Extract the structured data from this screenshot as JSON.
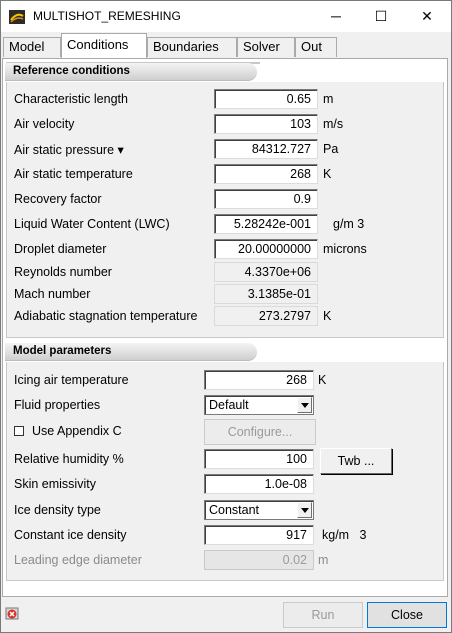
{
  "window": {
    "title": "MULTISHOT_REMESHING",
    "minimize": "─",
    "maximize": "☐",
    "close": "✕"
  },
  "tabs": [
    {
      "label": "Model"
    },
    {
      "label": "Conditions"
    },
    {
      "label": "Boundaries"
    },
    {
      "label": "Solver"
    },
    {
      "label": "Out"
    }
  ],
  "reference": {
    "header": "Reference conditions",
    "rows": [
      {
        "label": "Characteristic length",
        "value": "0.65",
        "unit": "m"
      },
      {
        "label": "Air velocity",
        "value": "103",
        "unit": "m/s"
      },
      {
        "label": "Air static pressure ▾",
        "value": "84312.727",
        "unit": "Pa"
      },
      {
        "label": "Air static temperature",
        "value": "268",
        "unit": "K"
      },
      {
        "label": "Recovery factor",
        "value": "0.9",
        "unit": ""
      },
      {
        "label": "Liquid Water Content (LWC)",
        "value": "5.28242e-001",
        "unit": "g/m 3"
      },
      {
        "label": "Droplet diameter",
        "value": "20.00000000",
        "unit": "microns"
      },
      {
        "label": "Reynolds number",
        "value": "4.3370e+06",
        "unit": ""
      },
      {
        "label": "Mach number",
        "value": "3.1385e-01",
        "unit": ""
      },
      {
        "label": "Adiabatic stagnation temperature",
        "value": "273.2797",
        "unit": "K"
      }
    ]
  },
  "model": {
    "header": "Model parameters",
    "icing_temp": {
      "label": "Icing air temperature",
      "value": "268",
      "unit": "K"
    },
    "fluid": {
      "label": "Fluid properties",
      "value": "Default"
    },
    "appendix": {
      "label": "Use Appendix C",
      "checked": false
    },
    "configure": "Configure...",
    "humidity": {
      "label": "Relative humidity %",
      "value": "100"
    },
    "twb": "Twb ...",
    "skin": {
      "label": "Skin emissivity",
      "value": "1.0e-08"
    },
    "ice_type": {
      "label": "Ice density type",
      "value": "Constant"
    },
    "ice_density": {
      "label": "Constant ice density",
      "value": "917",
      "unit": "kg/m   3"
    },
    "leading_edge": {
      "label": "Leading edge diameter",
      "value": "0.02",
      "unit": "m"
    }
  },
  "footer": {
    "run": "Run",
    "close": "Close"
  }
}
